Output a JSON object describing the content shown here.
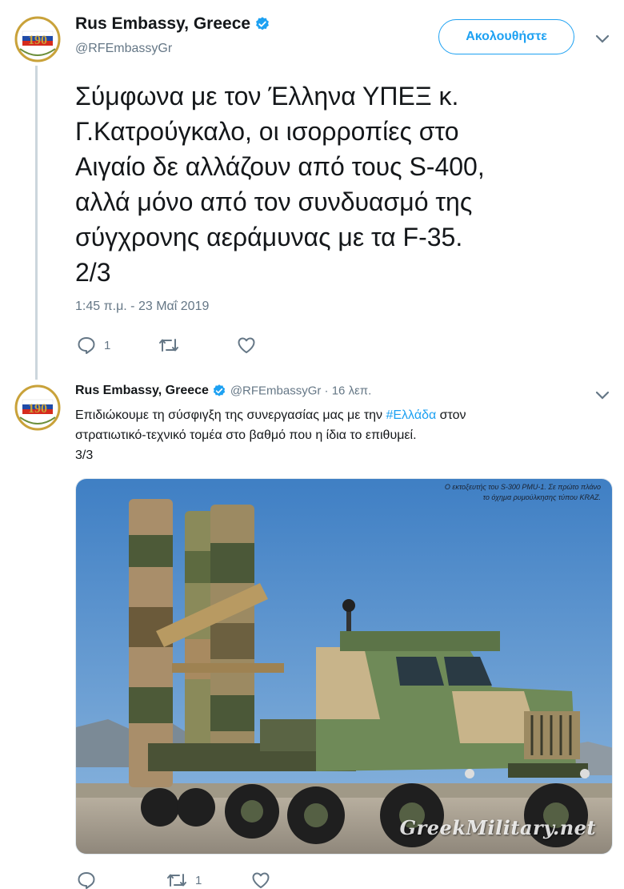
{
  "main_tweet": {
    "author_name": "Rus Embassy, Greece",
    "handle": "@RFEmbassyGr",
    "follow_label": "Ακολουθήστε",
    "text_lines": [
      "Σύμφωνα με τον Έλληνα ΥΠΕΞ κ.",
      "Γ.Κατρούγκαλο, οι ισορροπίες στο",
      "Αιγαίο δε αλλάζουν από τους S-400,",
      "αλλά μόνο από τον συνδυασμό της",
      "σύγχρονης αεράμυνας με τα F-35.",
      "2/3"
    ],
    "timestamp": "1:45 π.μ. - 23 Μαΐ 2019",
    "reply_count": "1",
    "retweet_count": "",
    "like_count": ""
  },
  "reply_tweet": {
    "author_name": "Rus Embassy, Greece",
    "handle_time": "@RFEmbassyGr · 16 λεπ.",
    "text_before": "Επιδιώκουμε τη σύσφιγξη της συνεργασίας μας με την ",
    "hashtag": "#Ελλάδα",
    "text_after": " στον",
    "line2": "στρατιωτικό-τεχνικό τομέα στο βαθμό που η ίδια  το επιθυμεί.",
    "line3": "3/3",
    "media_caption_line1": "Ο εκτοξευτής του S-300 PMU-1. Σε πρώτο πλάνο",
    "media_caption_line2": "το όχημα ρυμούλκησης τύπου KRAZ.",
    "media_watermark": "GreekMilitary.net",
    "reply_count": "",
    "retweet_count": "1",
    "like_count": ""
  },
  "avatar_badge_text": "190",
  "colors": {
    "accent": "#1da1f2",
    "muted": "#657786",
    "text": "#14171a",
    "thread_line": "#ccd6dd"
  }
}
